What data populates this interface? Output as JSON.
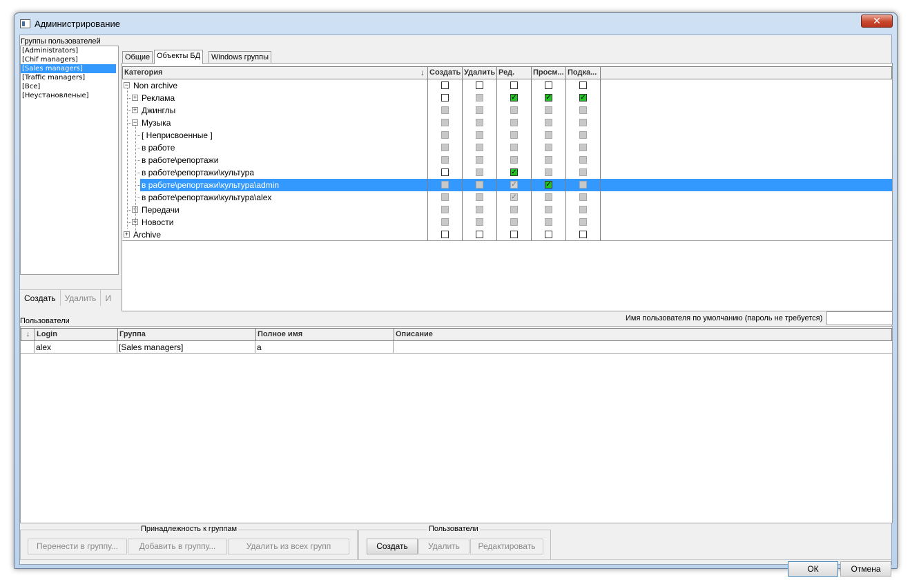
{
  "window": {
    "title": "Администрирование",
    "close_label": "✕"
  },
  "groups_panel": {
    "label": "Группы пользователей",
    "items": [
      "[Administrators]",
      "[Chif managers]",
      "[Sales managers]",
      "[Traffic managers]",
      "[Все]",
      "[Неустановленые]"
    ],
    "selected": "[Sales managers]",
    "buttons": {
      "create": "Создать",
      "delete": "Удалить",
      "third": "И"
    }
  },
  "tabs": [
    "Общие",
    "Объекты БД",
    "Windows группы"
  ],
  "active_tab": "Объекты БД",
  "permissions": {
    "columns": [
      "Категория",
      "Создать",
      "Удалить",
      "Ред.",
      "Просм...",
      "Подка..."
    ],
    "sort_icon": "↓",
    "rows": [
      {
        "label": "Non archive",
        "expander": "−",
        "states": [
          "empty",
          "empty",
          "empty",
          "empty",
          "empty"
        ]
      },
      {
        "label": "Реклама",
        "expander": "+",
        "states": [
          "empty",
          "gray",
          "green",
          "green",
          "green"
        ]
      },
      {
        "label": "Джинглы",
        "expander": "+",
        "states": [
          "gray",
          "gray",
          "gray",
          "gray",
          "gray"
        ]
      },
      {
        "label": "Музыка",
        "expander": "−",
        "states": [
          "gray",
          "gray",
          "gray",
          "gray",
          "gray"
        ]
      },
      {
        "label": "[ Неприсвоенные ]",
        "expander": "",
        "states": [
          "gray",
          "gray",
          "gray",
          "gray",
          "gray"
        ]
      },
      {
        "label": "в работе",
        "expander": "",
        "states": [
          "gray",
          "gray",
          "gray",
          "gray",
          "gray"
        ]
      },
      {
        "label": "в работе\\репортажи",
        "expander": "",
        "states": [
          "gray",
          "gray",
          "gray",
          "gray",
          "gray"
        ]
      },
      {
        "label": "в работе\\репортажи\\культура",
        "expander": "",
        "states": [
          "empty",
          "gray",
          "green",
          "gray",
          "gray"
        ]
      },
      {
        "label": "в работе\\репортажи\\культура\\admin",
        "expander": "",
        "states": [
          "gray",
          "gray",
          "graycheck",
          "green",
          "gray"
        ]
      },
      {
        "label": "в работе\\репортажи\\культура\\alex",
        "expander": "",
        "states": [
          "gray",
          "gray",
          "graycheck",
          "gray",
          "gray"
        ]
      },
      {
        "label": "Передачи",
        "expander": "+",
        "states": [
          "gray",
          "gray",
          "gray",
          "gray",
          "gray"
        ]
      },
      {
        "label": "Новости",
        "expander": "+",
        "states": [
          "gray",
          "gray",
          "gray",
          "gray",
          "gray"
        ]
      },
      {
        "label": "Archive",
        "expander": "+",
        "states": [
          "empty",
          "empty",
          "empty",
          "empty",
          "empty"
        ]
      }
    ],
    "selected_row": "в работе\\репортажи\\культура\\admin",
    "check_glyph": "✓"
  },
  "users": {
    "label": "Пользователи",
    "default_user_label": "Имя пользователя по умолчанию (пароль не требуется)",
    "default_user_value": "",
    "sort_icon": "↓",
    "columns": [
      "Login",
      "Группа",
      "Полное имя",
      "Описание"
    ],
    "rows": [
      {
        "login": "alex",
        "group": "[Sales managers]",
        "full_name": "a",
        "description": ""
      }
    ]
  },
  "membership_box": {
    "title": "Принадлежность к группам",
    "move": "Перенести в группу...",
    "add": "Добавить в группу...",
    "remove_all": "Удалить из всех групп"
  },
  "users_box": {
    "title": "Пользователи",
    "create": "Создать",
    "delete": "Удалить",
    "edit": "Редактировать"
  },
  "footer": {
    "ok": "ОК",
    "cancel": "Отмена"
  }
}
